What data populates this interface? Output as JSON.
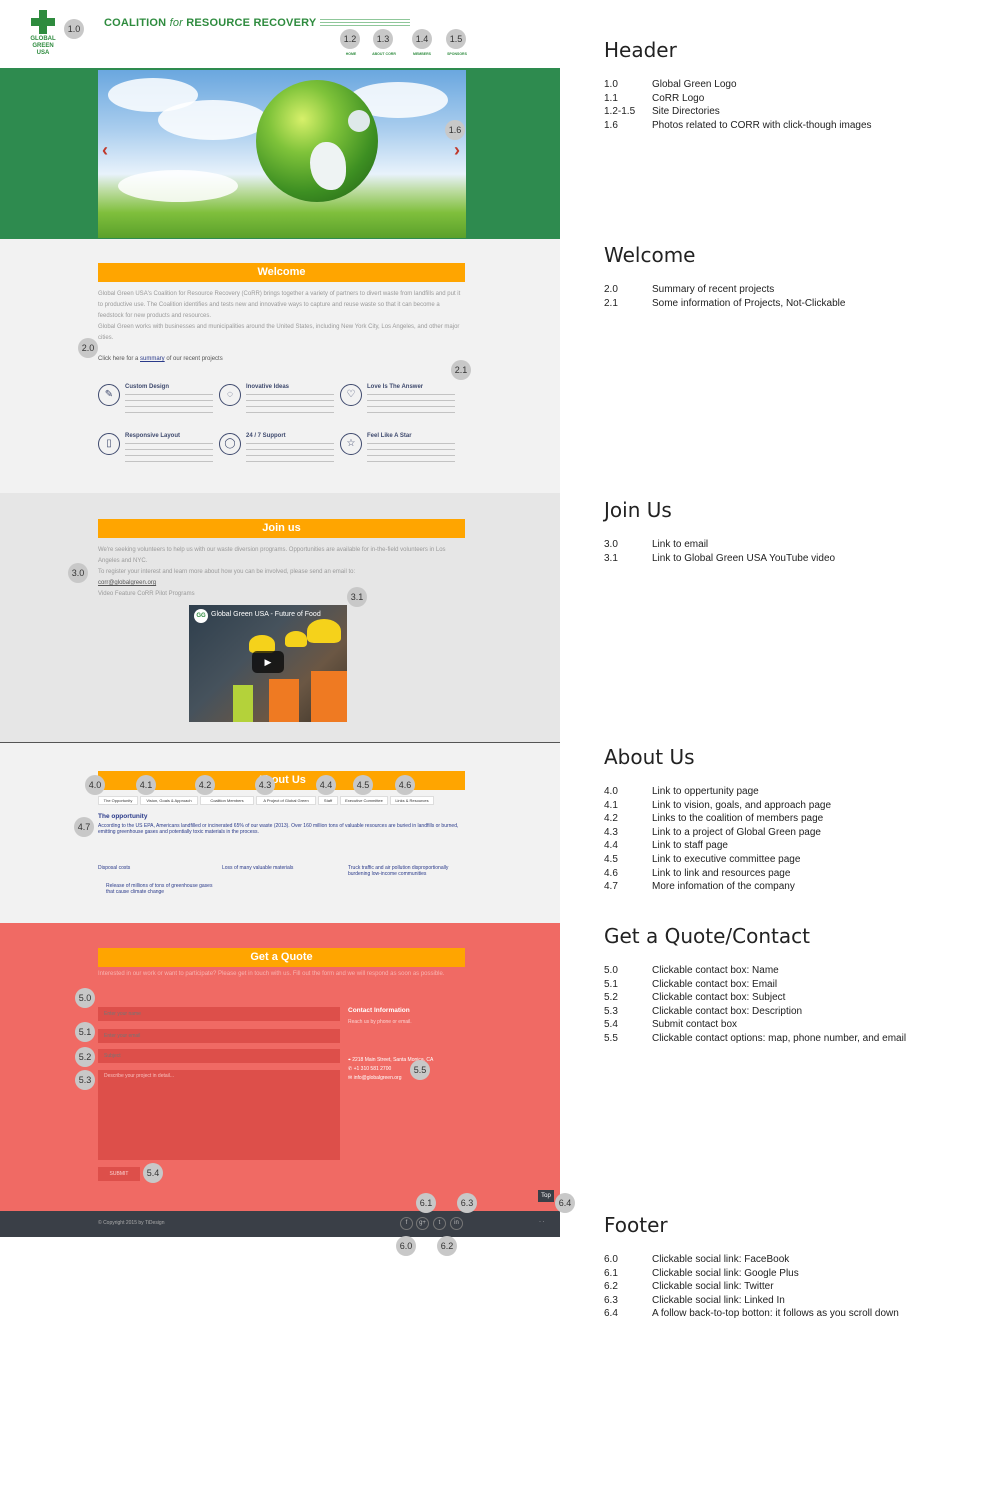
{
  "header": {
    "gg_logo_text": "GLOBAL GREEN USA",
    "corr_logo": {
      "part1": "COALITION ",
      "for": "for",
      "part2": " RESOURCE RECOVERY"
    },
    "nav": [
      "HOME",
      "ABOUT CORR",
      "MEMBERS",
      "SPONSORS"
    ]
  },
  "welcome": {
    "title": "Welcome",
    "body1": "Global Green USA's Coalition for Resource Recovery (CoRR) brings together a variety of partners to divert waste from landfills and put it to productive use. The Coalition identifies and tests new and innovative ways to capture and reuse waste so that it can become a feedstock for new products and resources.",
    "body2": "Global Green works with businesses and municipalities around the United States, including New York City, Los Angeles, and other major cities.",
    "link_lead": "Click here for a ",
    "link_text": "summary",
    "link_tail": " of our recent projects",
    "features": [
      {
        "icon": "pencil",
        "glyph": "✎",
        "title": "Custom Design"
      },
      {
        "icon": "lightbulb",
        "glyph": "◌",
        "title": "Inovative Ideas"
      },
      {
        "icon": "heart",
        "glyph": "♡",
        "title": "Love Is The Answer"
      },
      {
        "icon": "phone",
        "glyph": "▯",
        "title": "Responsive Layout"
      },
      {
        "icon": "chat",
        "glyph": "◯",
        "title": "24 / 7 Support"
      },
      {
        "icon": "star",
        "glyph": "☆",
        "title": "Feel Like A Star"
      }
    ]
  },
  "join": {
    "title": "Join us",
    "body1": "We're seeking volunteers to help us with our waste diversion programs. Opportunities are available for in-the-field volunteers in Los Angeles and NYC.",
    "body2": "To register your interest and learn more about how you can be involved, please send an email to:",
    "email": "corr@globalgreen.org",
    "video_label": "Video Feature CoRR Pilot Programs",
    "video_title": "Global Green USA - Future of Food"
  },
  "about": {
    "title": "About Us",
    "tabs": [
      "The Opportunity",
      "Vision, Goals & Approach",
      "Coalition Members",
      "A Project of Global Green",
      "Staff",
      "Executive Committee",
      "Links & Resources"
    ],
    "opp_title": "The opportunity",
    "opp_body": "According to the US EPA, Americans landfilled or incinerated 65% of our waste (2013). Over 160 million tons of valuable resources are buried in landfills or burned, emitting greenhouse gases and potentially toxic materials in the process.",
    "col1": "Disposal costs",
    "col2": "Loss of many valuable materials",
    "col3": "Truck traffic and air pollution disproportionally burdening low-income communities",
    "col4": "Release of millions of tons of greenhouse gases that cause climate change"
  },
  "quote": {
    "title": "Get a Quote",
    "intro": "Interested in our work or want to participate? Please get in touch with us. Fill out the form and we will respond as soon as possible.",
    "name_ph": "Enter your name",
    "email_ph": "Enter your email",
    "subject_ph": "Subject",
    "desc_ph": "Describe your project in detail...",
    "submit": "SUBMIT",
    "contact_title": "Contact Information",
    "contact_body": "Reach us by phone or email.",
    "address": "2218 Main Street, Santa Monica, CA",
    "phone": "+1 310 581 2700",
    "email": "info@globalgreen.org",
    "totop": "Top"
  },
  "footer": {
    "copyright": "© Copyright 2015 by TiDesign",
    "social": [
      "f",
      "g+",
      "t",
      "in"
    ]
  },
  "badges": {
    "b10": "1.0",
    "b12": "1.2",
    "b13": "1.3",
    "b14": "1.4",
    "b15": "1.5",
    "b16": "1.6",
    "b20": "2.0",
    "b21": "2.1",
    "b30": "3.0",
    "b31": "3.1",
    "b40": "4.0",
    "b41": "4.1",
    "b42": "4.2",
    "b43": "4.3",
    "b44": "4.4",
    "b45": "4.5",
    "b46": "4.6",
    "b47": "4.7",
    "b50": "5.0",
    "b51": "5.1",
    "b52": "5.2",
    "b53": "5.3",
    "b54": "5.4",
    "b55": "5.5",
    "b60": "6.0",
    "b61": "6.1",
    "b62": "6.2",
    "b63": "6.3",
    "b64": "6.4"
  },
  "legend": {
    "header": {
      "title": "Header",
      "rows": [
        {
          "k": "1.0",
          "v": "Global Green Logo"
        },
        {
          "k": "1.1",
          "v": "CoRR Logo"
        },
        {
          "k": "1.2-1.5",
          "v": "Site Directories"
        },
        {
          "k": "1.6",
          "v": "Photos related to CORR with click-though images"
        }
      ]
    },
    "welcome": {
      "title": "Welcome",
      "rows": [
        {
          "k": "2.0",
          "v": "Summary of recent projects"
        },
        {
          "k": "2.1",
          "v": "Some information of Projects, Not-Clickable"
        }
      ]
    },
    "join": {
      "title": "Join Us",
      "rows": [
        {
          "k": "3.0",
          "v": "Link to email"
        },
        {
          "k": "3.1",
          "v": "Link to Global Green USA YouTube video"
        }
      ]
    },
    "about": {
      "title": "About Us",
      "rows": [
        {
          "k": "4.0",
          "v": "Link to oppertunity page"
        },
        {
          "k": "4.1",
          "v": "Link to vision, goals, and approach page"
        },
        {
          "k": "4.2",
          "v": "Links to the coalition of members page"
        },
        {
          "k": "4.3",
          "v": "Link to a project of Global Green page"
        },
        {
          "k": "4.4",
          "v": "Link to staff page"
        },
        {
          "k": "4.5",
          "v": "Link to executive committee page"
        },
        {
          "k": "4.6",
          "v": "Link to link and resources page"
        },
        {
          "k": "4.7",
          "v": "More infomation of the company"
        }
      ]
    },
    "quote": {
      "title": "Get a Quote/Contact",
      "rows": [
        {
          "k": "5.0",
          "v": "Clickable contact box: Name"
        },
        {
          "k": "5.1",
          "v": "Clickable contact box: Email"
        },
        {
          "k": "5.2",
          "v": "Clickable contact box: Subject"
        },
        {
          "k": "5.3",
          "v": "Clickable contact box: Description"
        },
        {
          "k": "5.4",
          "v": "Submit contact box"
        },
        {
          "k": "5.5",
          "v": "Clickable contact options: map, phone number, and email"
        }
      ]
    },
    "footer": {
      "title": "Footer",
      "rows": [
        {
          "k": "6.0",
          "v": "Clickable social link: FaceBook"
        },
        {
          "k": "6.1",
          "v": "Clickable social link: Google Plus"
        },
        {
          "k": "6.2",
          "v": "Clickable social link: Twitter"
        },
        {
          "k": "6.3",
          "v": "Clickable social link: Linked In"
        },
        {
          "k": "6.4",
          "v": "A follow back-to-top botton: it follows as you scroll down"
        }
      ]
    }
  }
}
